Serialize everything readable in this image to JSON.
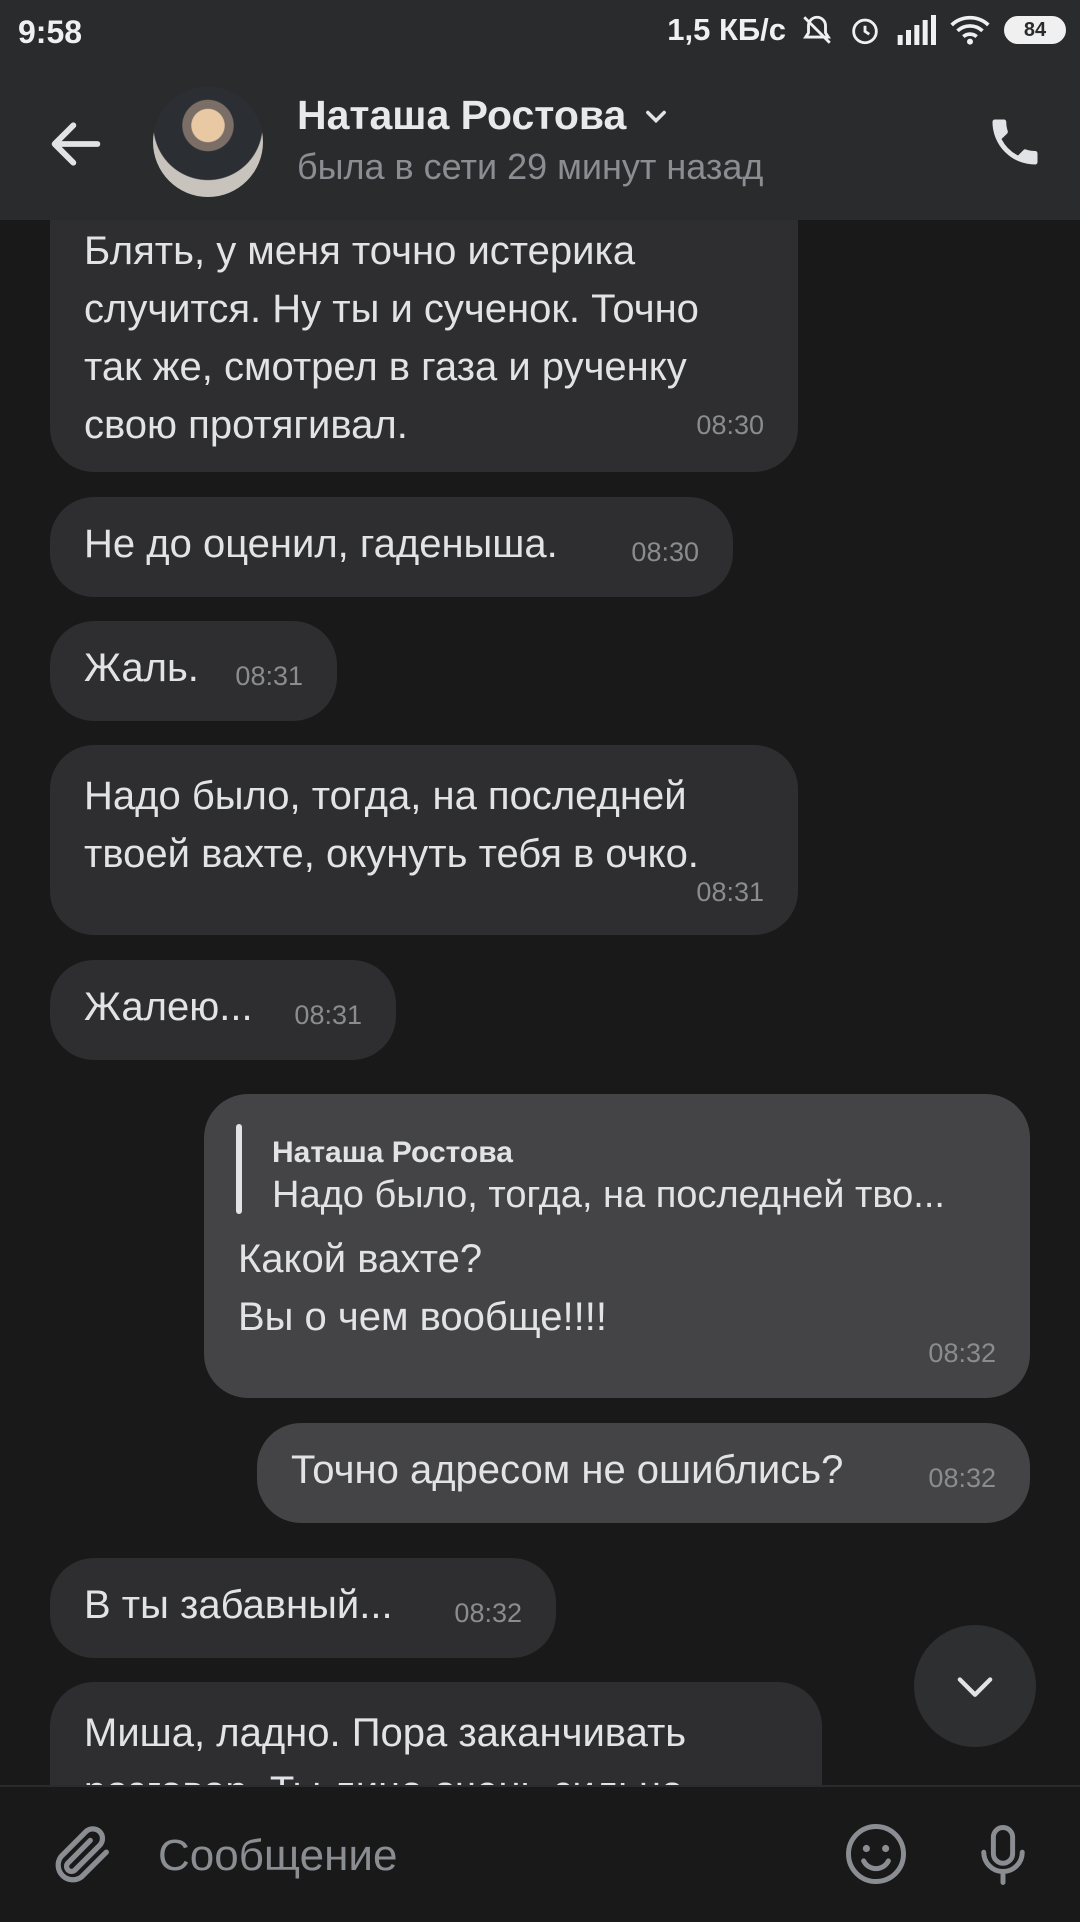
{
  "status_bar": {
    "time": "9:58",
    "net_rate": "1,5 КБ/с",
    "battery": "84"
  },
  "header": {
    "contact_name": "Наташа Ростова",
    "last_seen": "была в сети 29 минут назад"
  },
  "messages": [
    {
      "dir": "in",
      "text": "Блять, у меня точно истерика\nслучится. Ну ты и сученок. Точно\nтак же, смотрел в газа и рученку\nсвою протягивал.",
      "time": "08:30"
    },
    {
      "dir": "in",
      "text": "Не до оценил, гаденыша.",
      "time": "08:30"
    },
    {
      "dir": "in",
      "text": "Жаль.",
      "time": "08:31"
    },
    {
      "dir": "in",
      "text": "Надо было, тогда, на последней\nтвоей вахте, окунуть тебя в очко.",
      "time": "08:31"
    },
    {
      "dir": "in",
      "text": "Жалею...",
      "time": "08:31"
    },
    {
      "dir": "out",
      "reply_name": "Наташа Ростова",
      "reply_text": "Надо было, тогда, на последней тво...",
      "text": "Какой вахте?\nВы о чем вообще!!!!",
      "time": "08:32"
    },
    {
      "dir": "out",
      "text": "Точно адресом не ошиблись?",
      "time": "08:32"
    },
    {
      "dir": "in",
      "text": "В ты забавный...",
      "time": "08:32"
    },
    {
      "dir": "in",
      "text": "Миша, ладно. Пора заканчивать\nразговор. Ты лицо очень сильно",
      "time": ""
    }
  ],
  "composer": {
    "placeholder": "Сообщение"
  }
}
